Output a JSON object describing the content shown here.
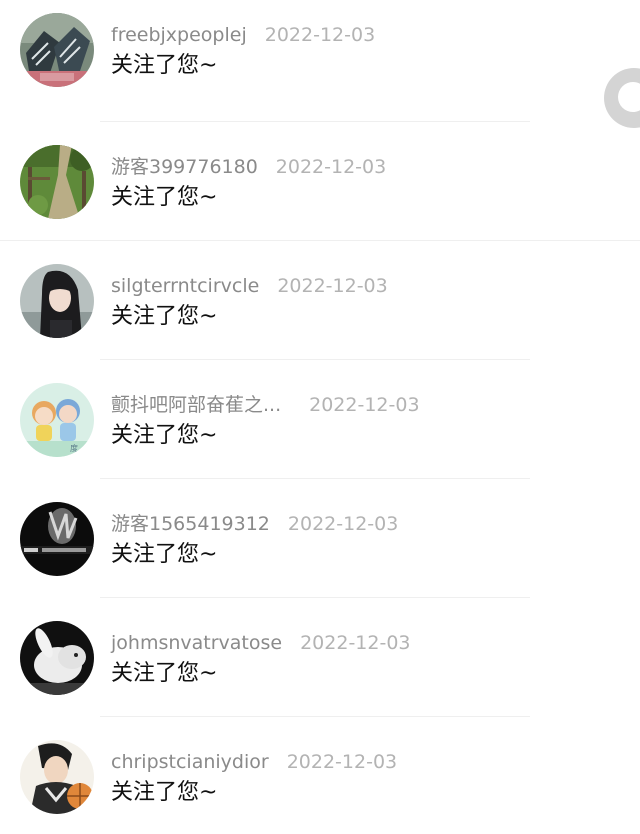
{
  "notifications": [
    {
      "username": "freebjxpeoplej",
      "date": "2022-12-03",
      "message": "关注了您~",
      "avatar": "sneakers-photo"
    },
    {
      "username": "游客399776180",
      "date": "2022-12-03",
      "message": "关注了您~",
      "avatar": "garden-path-photo"
    },
    {
      "username": "silgterrntcirvcle",
      "date": "2022-12-03",
      "message": "关注了您~",
      "avatar": "girl-portrait-photo"
    },
    {
      "username": "颤抖吧阿部奋萑之...",
      "date": "2022-12-03",
      "message": "关注了您~",
      "avatar": "cartoon-couple-illustration"
    },
    {
      "username": "游客1565419312",
      "date": "2022-12-03",
      "message": "关注了您~",
      "avatar": "dark-hands-photo"
    },
    {
      "username": "johmsnvatrvatose",
      "date": "2022-12-03",
      "message": "关注了您~",
      "avatar": "white-rabbit-photo"
    },
    {
      "username": "chripstcianiydior",
      "date": "2022-12-03",
      "message": "关注了您~",
      "avatar": "basketball-player-illustration"
    }
  ],
  "floating_button": {
    "icon": "circle-toggle-icon"
  }
}
